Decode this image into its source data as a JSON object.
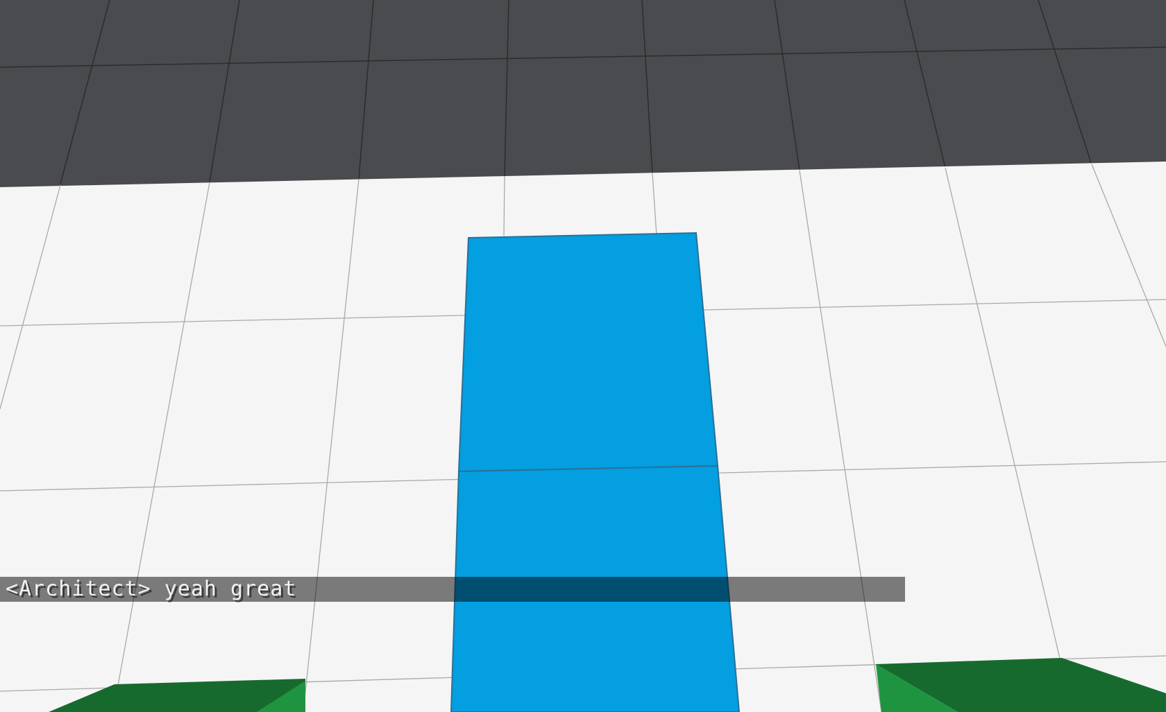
{
  "chat": {
    "messages": [
      {
        "text": "<Architect> yeah great"
      }
    ]
  },
  "colors": {
    "sky_floor": "#4a4b4e",
    "ground": "#f5f5f5",
    "ground_grid": "#a9a9a9",
    "dark_grid": "#2c2c2e",
    "blue_block": "#039fe0",
    "blue_edge": "#2b6f97",
    "green_block_top": "#176a2e",
    "green_block_side": "#1f9440",
    "chat_background": "rgba(0,0,0,0.5)",
    "chat_text": "#f2f2f2"
  },
  "blocks": [
    {
      "kind": "blue-block",
      "count": 2
    },
    {
      "kind": "green-block",
      "count": 2
    }
  ]
}
